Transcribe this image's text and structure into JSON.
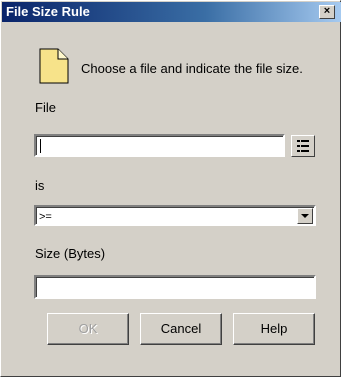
{
  "window": {
    "title": "File Size Rule",
    "close_glyph": "×"
  },
  "header": {
    "icon": "document-icon",
    "instruction": "Choose a file and indicate the file size."
  },
  "file": {
    "label": "File",
    "value": "",
    "browse_icon": "browse-list-icon"
  },
  "operator": {
    "label": "is",
    "selected": ">=",
    "dropdown_icon": "chevron-down-icon"
  },
  "size": {
    "label": "Size (Bytes)",
    "value": ""
  },
  "buttons": {
    "ok": "OK",
    "cancel": "Cancel",
    "help": "Help"
  }
}
